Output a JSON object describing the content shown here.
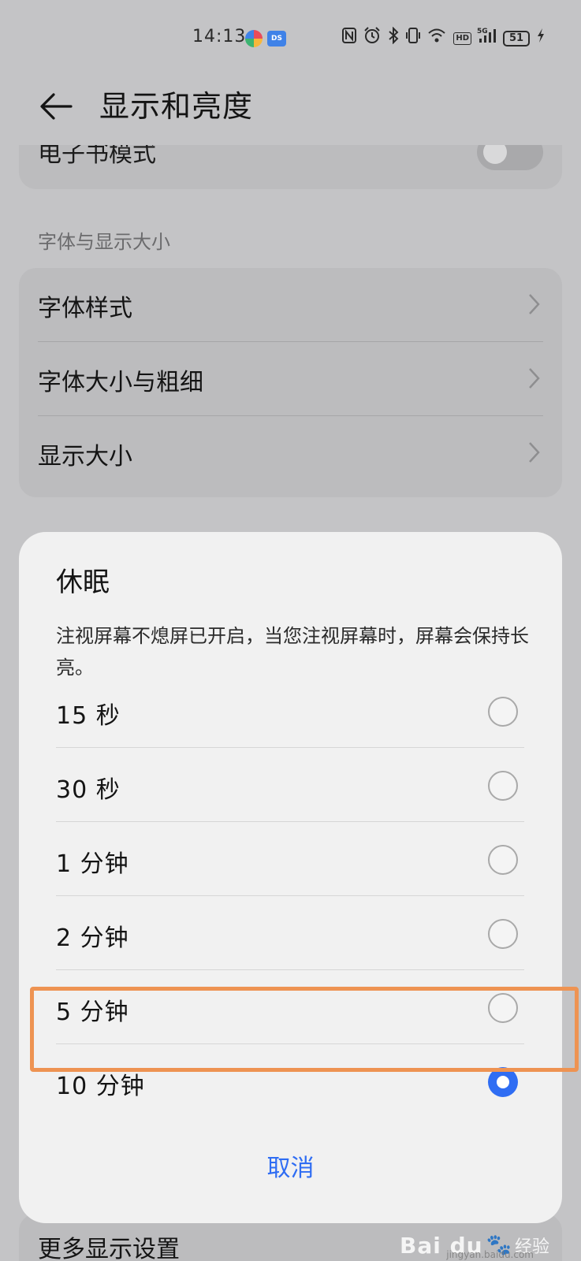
{
  "status_bar": {
    "time": "14:13",
    "app_icon_text": "DS",
    "icons": [
      "nfc-icon",
      "alarm-icon",
      "bluetooth-icon",
      "vibrate-icon",
      "wifi-icon",
      "hd-icon",
      "signal-5g-icon",
      "battery-icon",
      "charging-icon"
    ],
    "hd": "HD",
    "network": "5G",
    "battery": "51"
  },
  "header": {
    "title": "显示和亮度"
  },
  "background": {
    "ebook_mode_label": "电子书模式",
    "section_font_label": "字体与显示大小",
    "font_items": [
      "字体样式",
      "字体大小与粗细",
      "显示大小"
    ],
    "more_settings_label": "更多显示设置"
  },
  "dialog": {
    "title": "休眠",
    "description": "注视屏幕不熄屏已开启，当您注视屏幕时，屏幕会保持长亮。",
    "options": [
      {
        "label": "15 秒",
        "selected": false
      },
      {
        "label": "30 秒",
        "selected": false
      },
      {
        "label": "1 分钟",
        "selected": false
      },
      {
        "label": "2 分钟",
        "selected": false
      },
      {
        "label": "5 分钟",
        "selected": false
      },
      {
        "label": "10 分钟",
        "selected": true
      }
    ],
    "cancel_label": "取消"
  },
  "watermark": {
    "brand": "Bai du",
    "tag": "经验",
    "url": "jingyan.baidu.com"
  },
  "colors": {
    "accent": "#2f6df3",
    "highlight": "#ee9352",
    "dim_background": "#c4c4c6",
    "dialog_background": "#f1f1f1"
  }
}
